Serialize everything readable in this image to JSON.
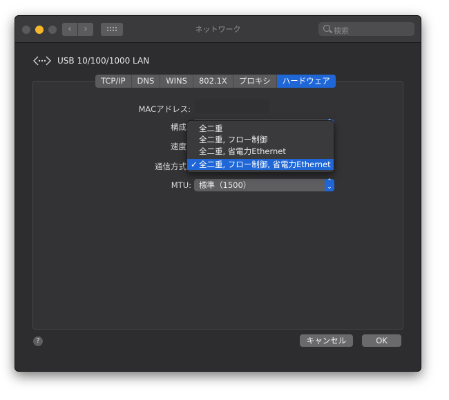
{
  "window": {
    "title": "ネットワーク",
    "search_placeholder": "検索",
    "nav_back": "‹",
    "nav_forward": "›"
  },
  "interface": {
    "name": "USB 10/100/1000 LAN",
    "icon": "ethernet-icon"
  },
  "tabs": [
    {
      "label": "TCP/IP"
    },
    {
      "label": "DNS"
    },
    {
      "label": "WINS"
    },
    {
      "label": "802.1X"
    },
    {
      "label": "プロキシ"
    },
    {
      "label": "ハードウェア",
      "active": true
    }
  ],
  "form": {
    "mac_label": "MACアドレス:",
    "config_label": "構成",
    "speed_label": "速度",
    "duplex_label": "通信方式",
    "mtu_label": "MTU:",
    "mtu_value": "標準（1500）"
  },
  "duplex_menu": {
    "items": [
      {
        "label": "全二重"
      },
      {
        "label": "全二重, フロー制御"
      },
      {
        "label": "全二重, 省電力Ethernet"
      },
      {
        "label": "全二重, フロー制御, 省電力Ethernet",
        "selected": true
      }
    ],
    "check_mark": "✓"
  },
  "buttons": {
    "help": "?",
    "cancel": "キャンセル",
    "ok": "OK"
  },
  "colors": {
    "accent": "#1f67d7",
    "window_bg": "#2d2d2f"
  }
}
